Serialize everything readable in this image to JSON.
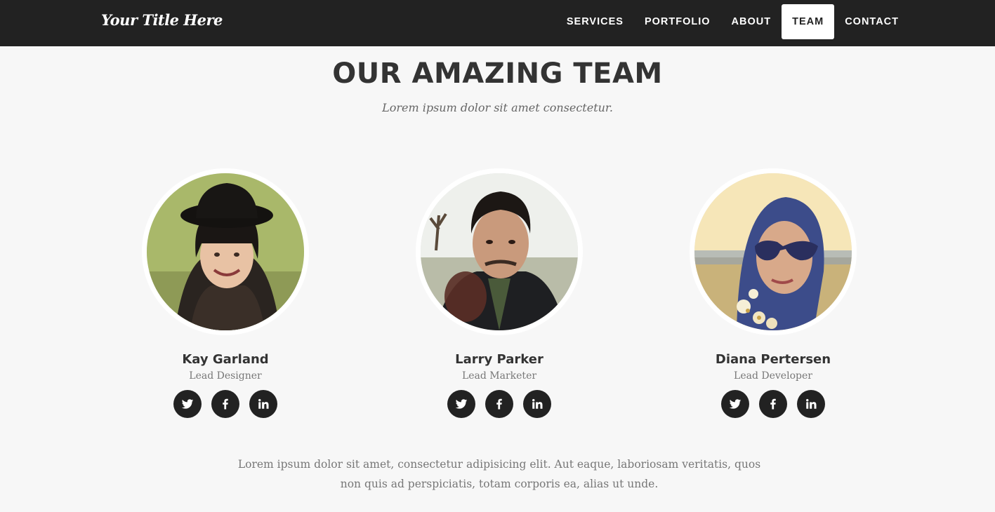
{
  "navbar": {
    "brand": "Your Title Here",
    "items": [
      {
        "label": "SERVICES",
        "active": false
      },
      {
        "label": "PORTFOLIO",
        "active": false
      },
      {
        "label": "ABOUT",
        "active": false
      },
      {
        "label": "TEAM",
        "active": true
      },
      {
        "label": "CONTACT",
        "active": false
      }
    ]
  },
  "section": {
    "heading": "OUR AMAZING TEAM",
    "subheading": "Lorem ipsum dolor sit amet consectetur.",
    "footer_text": "Lorem ipsum dolor sit amet, consectetur adipisicing elit. Aut eaque, laboriosam veritatis, quos non quis ad perspiciatis, totam corporis ea, alias ut unde."
  },
  "team": [
    {
      "name": "Kay Garland",
      "role": "Lead Designer",
      "socials": [
        "twitter-icon",
        "facebook-icon",
        "linkedin-icon"
      ]
    },
    {
      "name": "Larry Parker",
      "role": "Lead Marketer",
      "socials": [
        "twitter-icon",
        "facebook-icon",
        "linkedin-icon"
      ]
    },
    {
      "name": "Diana Pertersen",
      "role": "Lead Developer",
      "socials": [
        "twitter-icon",
        "facebook-icon",
        "linkedin-icon"
      ]
    }
  ],
  "colors": {
    "navbar_bg": "#222222",
    "page_bg": "#f7f7f7",
    "social_bg": "#222222",
    "heading": "#333333"
  }
}
